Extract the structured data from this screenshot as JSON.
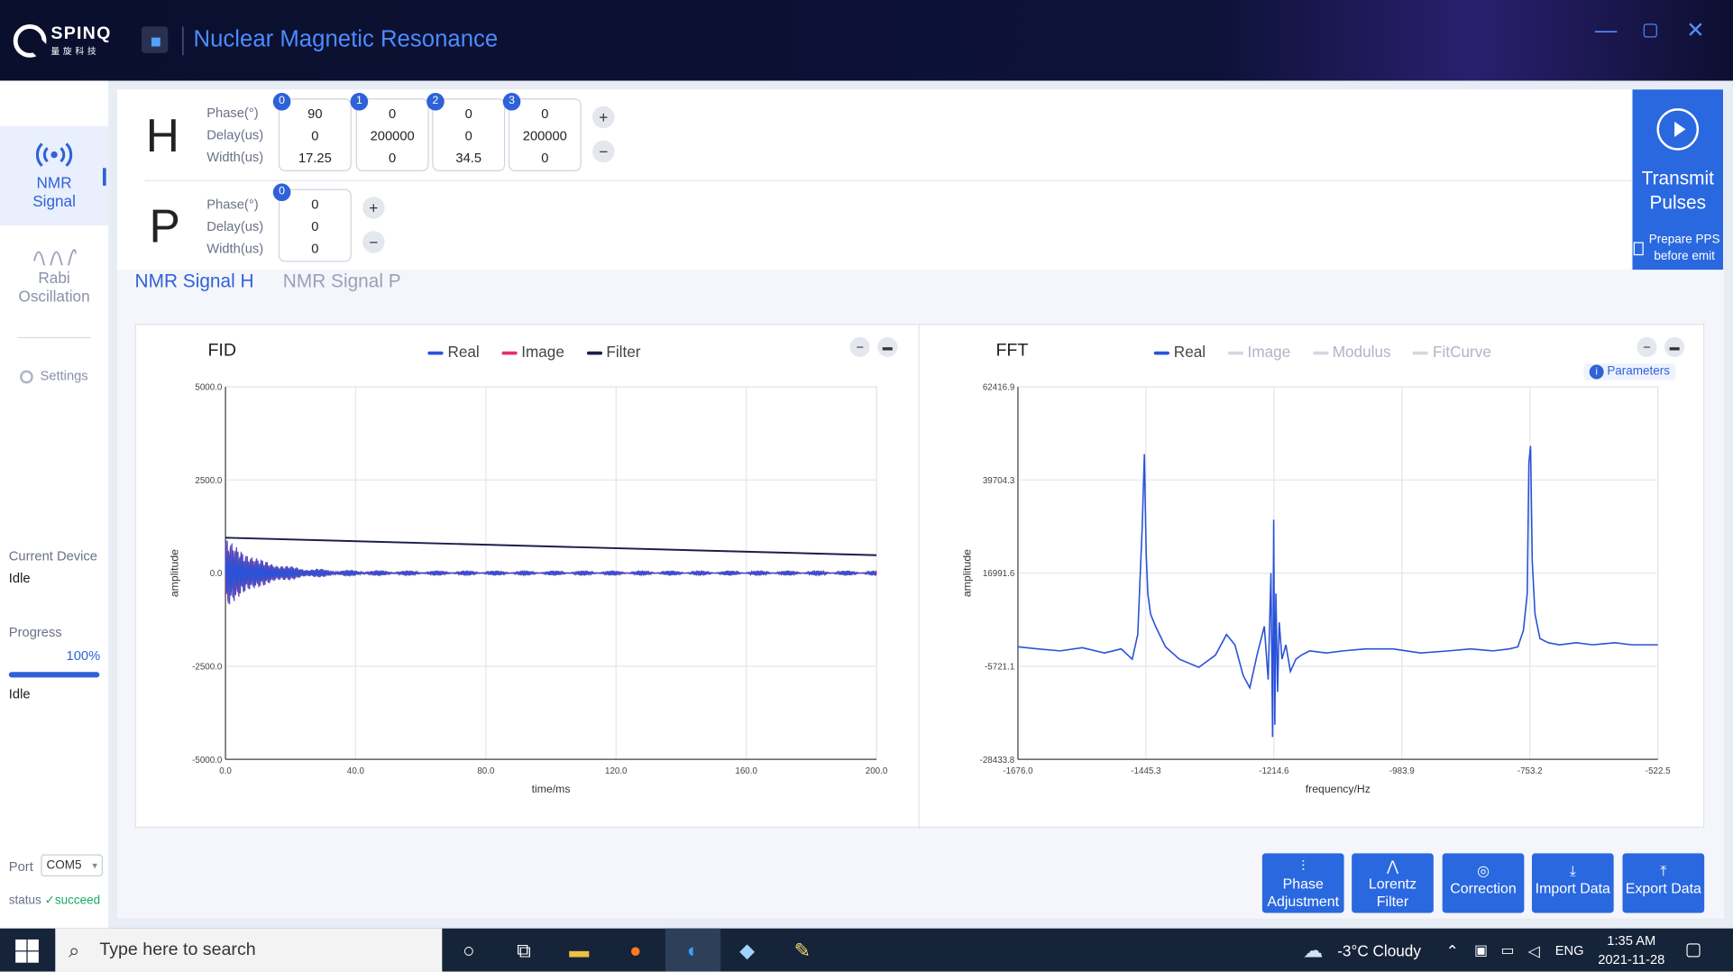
{
  "titlebar": {
    "brand": "SPINQ",
    "brand_sub": "量旋科技",
    "title": "Nuclear Magnetic Resonance",
    "minimize": "—",
    "maximize": "▢",
    "close": "✕"
  },
  "sidebar": {
    "items": [
      {
        "label1": "NMR",
        "label2": "Signal"
      },
      {
        "label1": "Rabi",
        "label2": "Oscillation"
      },
      {
        "label1": "Settings"
      }
    ],
    "current_device_label": "Current Device",
    "current_device": "Idle",
    "progress_label": "Progress",
    "progress_value": "100%",
    "progress_fraction": 1.0,
    "progress_status": "Idle",
    "port_label": "Port",
    "port_value": "COM5",
    "status_label": "status",
    "status_value": "succeed"
  },
  "pulses": {
    "labels": [
      "Phase(°)",
      "Delay(us)",
      "Width(us)"
    ],
    "H": {
      "letter": "H",
      "cards": [
        {
          "idx": "0",
          "phase": "90",
          "delay": "0",
          "width": "17.25"
        },
        {
          "idx": "1",
          "phase": "0",
          "delay": "200000",
          "width": "0"
        },
        {
          "idx": "2",
          "phase": "0",
          "delay": "0",
          "width": "34.5"
        },
        {
          "idx": "3",
          "phase": "0",
          "delay": "200000",
          "width": "0"
        }
      ]
    },
    "P": {
      "letter": "P",
      "cards": [
        {
          "idx": "0",
          "phase": "0",
          "delay": "0",
          "width": "0"
        }
      ]
    },
    "plus": "+",
    "minus": "−"
  },
  "transmit": {
    "label1": "Transmit",
    "label2": "Pulses",
    "prepare1": "Prepare PPS",
    "prepare2": "before emit"
  },
  "tabs": [
    "NMR Signal H",
    "NMR Signal P"
  ],
  "fid": {
    "title": "FID",
    "legend": [
      "Real",
      "Image",
      "Filter"
    ],
    "colors": {
      "real": "#2a52d8",
      "image": "#e0336a",
      "filter": "#1a1f4a"
    }
  },
  "fft": {
    "title": "FFT",
    "legend": [
      "Real",
      "Image",
      "Modulus",
      "FitCurve"
    ],
    "params_label": "Parameters",
    "colors": {
      "real": "#2a52d8",
      "muted": "#c8ccd8"
    }
  },
  "chart_data": [
    {
      "type": "line",
      "title": "FID",
      "xlabel": "time/ms",
      "ylabel": "amplitude",
      "xlim": [
        0,
        200
      ],
      "ylim": [
        -5000,
        5000
      ],
      "xticks": [
        "0.0",
        "40.0",
        "80.0",
        "120.0",
        "160.0",
        "200.0"
      ],
      "yticks": [
        "5000.0",
        "2500.0",
        "0.0",
        "-2500.0",
        "-5000.0"
      ],
      "series": [
        {
          "name": "Real",
          "decay_start_amplitude": 900,
          "note_shape": "decaying oscillation"
        },
        {
          "name": "Filter",
          "x": [
            0,
            200
          ],
          "y": [
            950,
            480
          ]
        }
      ]
    },
    {
      "type": "line",
      "title": "FFT",
      "xlabel": "frequency/Hz",
      "ylabel": "amplitude",
      "xlim": [
        -1676.0,
        -522.5
      ],
      "ylim": [
        -28433.8,
        62416.9
      ],
      "xticks": [
        "-1676.0",
        "-1445.3",
        "-1214.6",
        "-983.9",
        "-753.2",
        "-522.5"
      ],
      "yticks": [
        "62416.9",
        "39704.3",
        "16991.6",
        "-5721.1",
        "-28433.8"
      ],
      "series": [
        {
          "name": "Real",
          "x": [
            -1676,
            -1640,
            -1600,
            -1560,
            -1520,
            -1490,
            -1470,
            -1460,
            -1452,
            -1448,
            -1445,
            -1442,
            -1437,
            -1428,
            -1410,
            -1385,
            -1350,
            -1320,
            -1300,
            -1285,
            -1270,
            -1258,
            -1245,
            -1232,
            -1225,
            -1220,
            -1217,
            -1215,
            -1213,
            -1211,
            -1208,
            -1205,
            -1200,
            -1193,
            -1185,
            -1175,
            -1165,
            -1150,
            -1120,
            -1090,
            -1050,
            -1000,
            -950,
            -900,
            -860,
            -820,
            -790,
            -775,
            -765,
            -758,
            -755,
            -752,
            -749,
            -744,
            -735,
            -720,
            -700,
            -670,
            -640,
            -600,
            -570,
            -540,
            -522.5
          ],
          "y": [
            -1000,
            -1500,
            -2000,
            -1200,
            -2500,
            -1500,
            -4000,
            2000,
            28000,
            46000,
            22000,
            12000,
            7000,
            4000,
            -1000,
            -4000,
            -6000,
            -3000,
            2000,
            -500,
            -8000,
            -11000,
            -3000,
            4000,
            -9000,
            17000,
            -23000,
            30000,
            -20000,
            12000,
            -12000,
            5000,
            -4000,
            -500,
            -7000,
            -4000,
            -3000,
            -2000,
            -2500,
            -2000,
            -1500,
            -1500,
            -2500,
            -2000,
            -1500,
            -2000,
            -1500,
            -1000,
            3000,
            12000,
            44000,
            48000,
            20000,
            7000,
            1000,
            0,
            -500,
            0,
            -500,
            0,
            -500,
            -500,
            -500
          ]
        }
      ]
    }
  ],
  "actions": [
    {
      "icon": "⫶",
      "label1": "Phase",
      "label2": "Adjustment"
    },
    {
      "icon": "⋀",
      "label1": "Lorentz",
      "label2": "Filter"
    },
    {
      "icon": "◎",
      "label1": "Correction",
      "label2": ""
    },
    {
      "icon": "⤓",
      "label1": "Import Data",
      "label2": ""
    },
    {
      "icon": "⤒",
      "label1": "Export Data",
      "label2": ""
    }
  ],
  "taskbar": {
    "search_placeholder": "Type here to search",
    "weather": "-3°C  Cloudy",
    "lang": "ENG",
    "time": "1:35 AM",
    "date": "2021-11-28"
  }
}
